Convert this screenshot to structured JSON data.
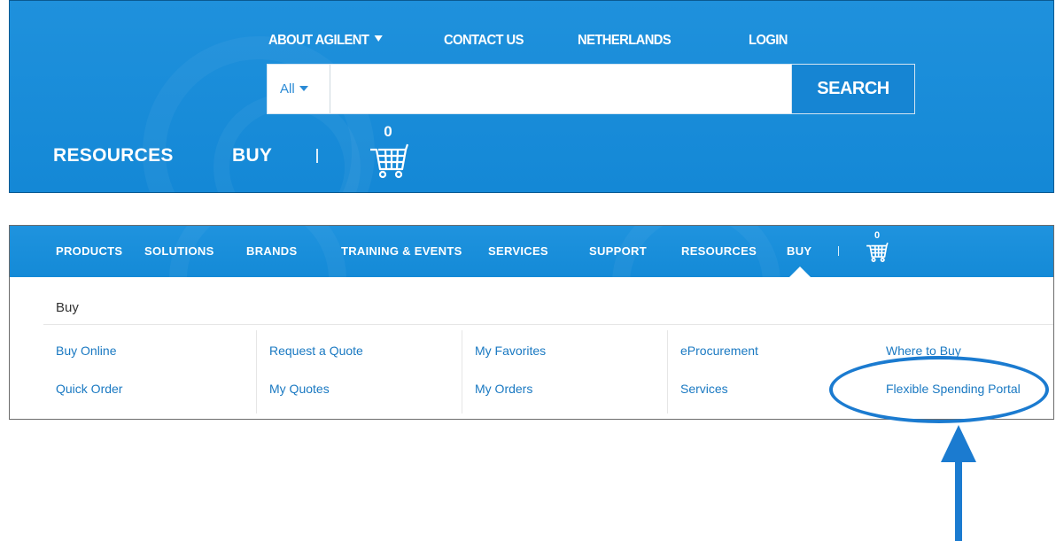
{
  "header": {
    "links": [
      {
        "label": "ABOUT AGILENT",
        "has_dropdown": true
      },
      {
        "label": "CONTACT US"
      },
      {
        "label": "NETHERLANDS"
      },
      {
        "label": "LOGIN"
      }
    ],
    "search": {
      "scope": "All",
      "placeholder": "",
      "value": "",
      "button_label": "SEARCH"
    },
    "bottom_links": [
      "RESOURCES",
      "BUY"
    ],
    "cart_count": "0"
  },
  "nav": {
    "items": [
      "PRODUCTS",
      "SOLUTIONS",
      "BRANDS",
      "TRAINING & EVENTS",
      "SERVICES",
      "SUPPORT",
      "RESOURCES",
      "BUY"
    ],
    "active_item": "BUY",
    "cart_count": "0"
  },
  "menu": {
    "heading": "Buy",
    "columns": [
      [
        "Buy Online",
        "Quick Order"
      ],
      [
        "Request a Quote",
        "My Quotes"
      ],
      [
        "My Favorites",
        "My Orders"
      ],
      [
        "eProcurement",
        "Services"
      ],
      [
        "Where to Buy",
        "Flexible Spending Portal"
      ]
    ],
    "highlighted_item": "Flexible Spending Portal"
  },
  "icons": {
    "cart": "shopping-cart-icon",
    "dropdown": "caret-down-icon",
    "annotation": "highlight-ellipse",
    "annotation_arrow": "up-arrow-icon"
  },
  "colors": {
    "brand_blue": "#1488d6",
    "search_button": "#1685d3",
    "link_blue": "#1a79c2",
    "annotation_blue": "#1b7bd0"
  }
}
